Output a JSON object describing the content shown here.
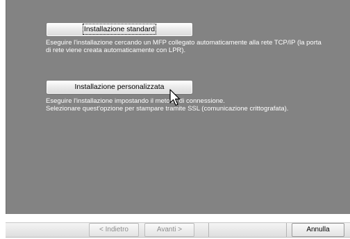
{
  "options": {
    "standard": {
      "button_label": "Installazione standard",
      "description": [
        "Eseguire l'installazione cercando un MFP collegato automaticamente alla rete TCP/IP (la porta",
        "di rete viene creata automaticamente con LPR)."
      ]
    },
    "custom": {
      "button_label": "Installazione personalizzata",
      "description": [
        "Eseguire l'installazione impostando il metodo di connessione.",
        "Selezionare quest'opzione per stampare tramite SSL (comunicazione crittografata)."
      ]
    }
  },
  "footer": {
    "back_label": "< Indietro",
    "next_label": "Avanti >",
    "cancel_label": "Annulla"
  },
  "colors": {
    "panel_background": "#838383",
    "description_text": "#ffffff",
    "disabled_text": "#8d8d8d"
  },
  "icons": {
    "mouse_cursor": "arrow-cursor-icon"
  }
}
